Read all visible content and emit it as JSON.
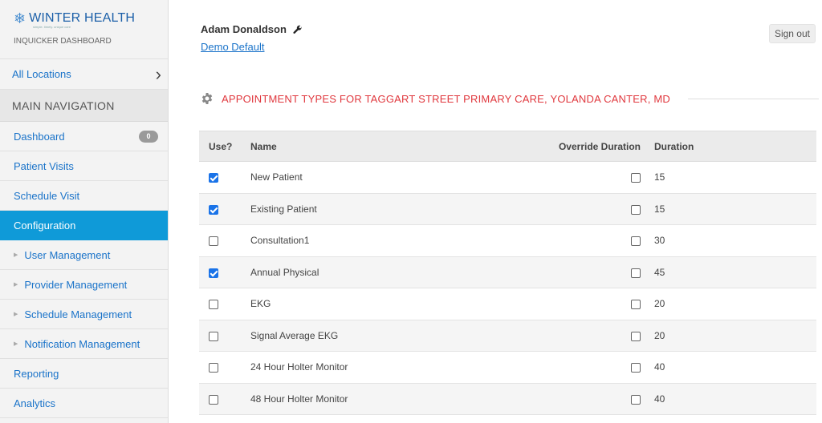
{
  "brand": {
    "name": "WINTER HEALTH",
    "tagline": "simple. timely. unique care",
    "subtitle": "INQUICKER DASHBOARD"
  },
  "location_selector": {
    "label": "All Locations"
  },
  "nav": {
    "heading": "MAIN NAVIGATION",
    "dashboard": {
      "label": "Dashboard",
      "badge": "0"
    },
    "patient_visits": "Patient Visits",
    "schedule_visit": "Schedule Visit",
    "configuration": "Configuration",
    "user_management": "User Management",
    "provider_management": "Provider Management",
    "schedule_management": "Schedule Management",
    "notification_management": "Notification Management",
    "reporting": "Reporting",
    "analytics": "Analytics"
  },
  "header": {
    "user_name": "Adam Donaldson",
    "organization_link": "Demo Default",
    "sign_out": "Sign out"
  },
  "section": {
    "title": "APPOINTMENT TYPES FOR TAGGART STREET PRIMARY CARE, YOLANDA CANTER, MD"
  },
  "table": {
    "headers": {
      "use": "Use?",
      "name": "Name",
      "override": "Override Duration",
      "duration": "Duration"
    },
    "rows": [
      {
        "use": true,
        "name": "New Patient",
        "override": false,
        "duration": "15"
      },
      {
        "use": true,
        "name": "Existing Patient",
        "override": false,
        "duration": "15"
      },
      {
        "use": false,
        "name": "Consultation1",
        "override": false,
        "duration": "30"
      },
      {
        "use": true,
        "name": "Annual Physical",
        "override": false,
        "duration": "45"
      },
      {
        "use": false,
        "name": "EKG",
        "override": false,
        "duration": "20"
      },
      {
        "use": false,
        "name": "Signal Average EKG",
        "override": false,
        "duration": "20"
      },
      {
        "use": false,
        "name": "24 Hour Holter Monitor",
        "override": false,
        "duration": "40"
      },
      {
        "use": false,
        "name": "48 Hour Holter Monitor",
        "override": false,
        "duration": "40"
      }
    ]
  },
  "colors": {
    "accent_active": "#0f9ad8",
    "link": "#1a73c9",
    "section_title": "#e0383e",
    "checkbox_checked": "#1a73e8"
  }
}
